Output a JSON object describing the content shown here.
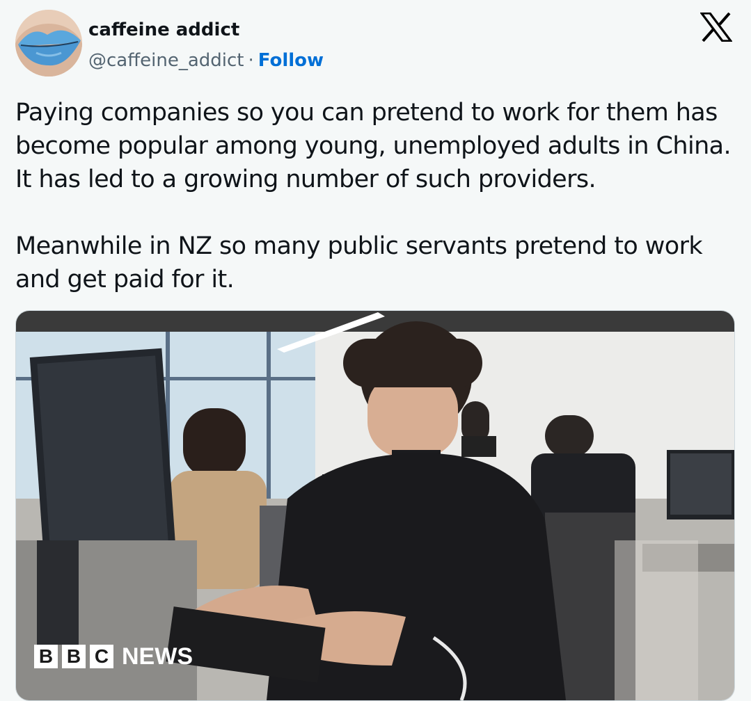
{
  "author": {
    "display_name": "caffeine addict",
    "handle": "@caffeine_addict",
    "separator": "·",
    "follow_label": "Follow",
    "avatar_icon": "lips-avatar-icon"
  },
  "platform": {
    "logo_icon": "x-logo-icon"
  },
  "tweet": {
    "paragraph_1": "Paying companies so you can pretend to work for them has become popular among young, unemployed adults in China. It has led to a growing number of such providers.",
    "paragraph_2": "Meanwhile in NZ so many public servants pretend to work and get paid for it."
  },
  "media": {
    "badge": {
      "letters": [
        "B",
        "B",
        "C"
      ],
      "word": "NEWS"
    }
  },
  "colors": {
    "background": "#f5f8f8",
    "text_primary": "#0f1419",
    "text_secondary": "#536471",
    "follow_link": "#006fd6"
  }
}
